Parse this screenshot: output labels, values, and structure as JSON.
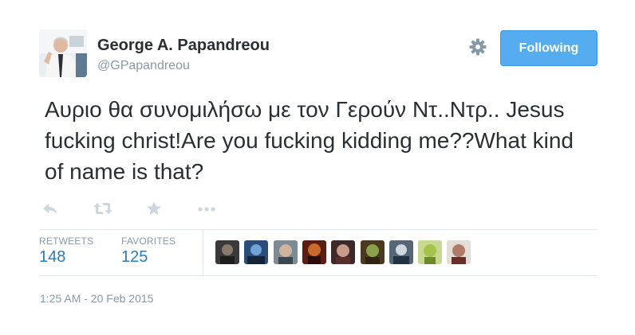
{
  "author": {
    "display_name": "George A. Papandreou",
    "handle": "@GPapandreou",
    "avatar_icon": "profile-photo"
  },
  "header": {
    "follow_label": "Following",
    "settings_icon": "gear-icon",
    "accent_color": "#55acee"
  },
  "tweet": {
    "text": "Αυριο θα συνομιλήσω με τον Γερούν Ντ..Ντρ.. Jesus fucking christ!Are you fucking kidding me??What kind of name is that?"
  },
  "actions": [
    {
      "name": "reply-icon"
    },
    {
      "name": "retweet-icon"
    },
    {
      "name": "favorite-icon"
    },
    {
      "name": "more-icon"
    }
  ],
  "stats": {
    "retweets_label": "RETWEETS",
    "retweets_count": "148",
    "favorites_label": "FAVORITES",
    "favorites_count": "125"
  },
  "favoriters": [
    {
      "name": "favoriter-avatar-1"
    },
    {
      "name": "favoriter-avatar-2"
    },
    {
      "name": "favoriter-avatar-3"
    },
    {
      "name": "favoriter-avatar-4"
    },
    {
      "name": "favoriter-avatar-5"
    },
    {
      "name": "favoriter-avatar-6"
    },
    {
      "name": "favoriter-avatar-7"
    },
    {
      "name": "favoriter-avatar-8"
    },
    {
      "name": "favoriter-avatar-9"
    }
  ],
  "timestamp": "1:25 AM - 20 Feb 2015"
}
